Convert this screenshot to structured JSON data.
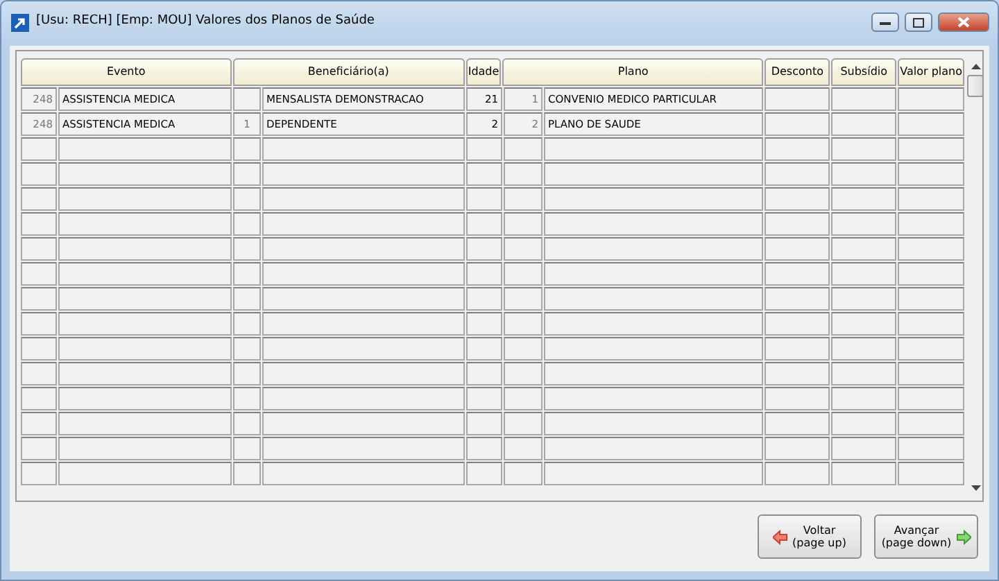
{
  "window": {
    "title": "[Usu: RECH] [Emp: MOU] Valores dos Planos de Saúde"
  },
  "table": {
    "columns": [
      "Evento",
      "Beneficiário(a)",
      "Idade",
      "Plano",
      "Desconto",
      "Subsídio",
      "Valor plano"
    ],
    "rows": [
      {
        "evento_code": "248",
        "evento": "ASSISTENCIA MEDICA",
        "beneficiario": "MENSALISTA DEMONSTRACAO",
        "idade": "21",
        "plano_code": "1",
        "plano": "CONVENIO MEDICO PARTICULAR"
      },
      {
        "evento_code": "248",
        "evento": "ASSISTENCIA MEDICA",
        "beneficiario_code": "1",
        "beneficiario": "DEPENDENTE",
        "idade": "2",
        "plano_code": "2",
        "plano": "PLANO DE SAUDE"
      }
    ]
  },
  "buttons": [
    {
      "kind": "back",
      "label": "Voltar",
      "sublabel": "(page up)"
    },
    {
      "kind": "forward",
      "label": "Avançar",
      "sublabel": "(page down)"
    }
  ]
}
